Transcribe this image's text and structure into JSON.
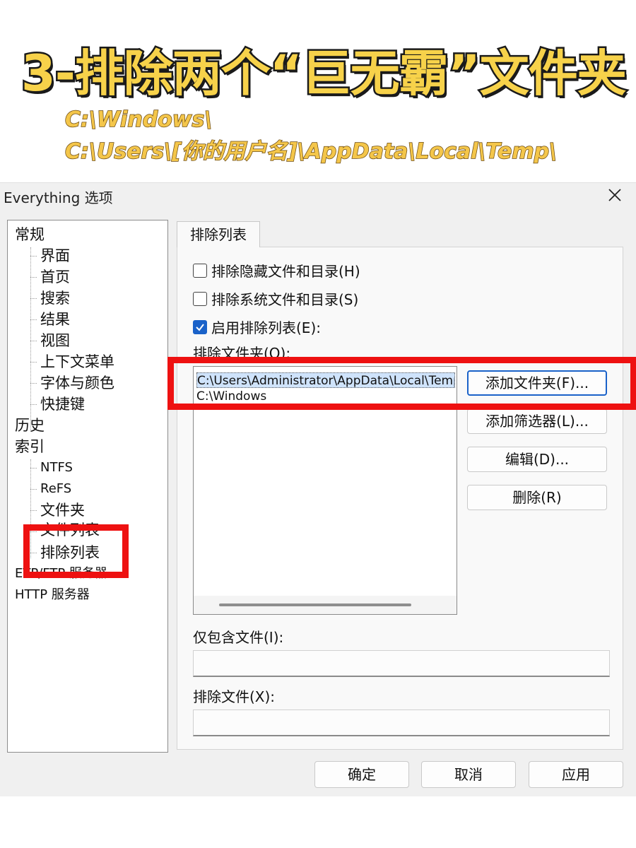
{
  "banner": {
    "title": "3-排除两个“巨无霸”文件夹",
    "paths": [
      "C:\\Windows\\",
      "C:\\Users\\[你的用户名]\\AppData\\Local\\Temp\\"
    ]
  },
  "dialog": {
    "title": "Everything 选项",
    "close_glyph": "✕",
    "tree": [
      {
        "id": "general",
        "label": "常规"
      },
      {
        "id": "ui",
        "label": "界面"
      },
      {
        "id": "home",
        "label": "首页"
      },
      {
        "id": "search",
        "label": "搜索"
      },
      {
        "id": "results",
        "label": "结果"
      },
      {
        "id": "view",
        "label": "视图"
      },
      {
        "id": "context-menu",
        "label": "上下文菜单"
      },
      {
        "id": "font-color",
        "label": "字体与颜色"
      },
      {
        "id": "shortcuts",
        "label": "快捷键"
      },
      {
        "id": "history",
        "label": "历史"
      },
      {
        "id": "index",
        "label": "索引"
      },
      {
        "id": "ntfs",
        "label": "NTFS"
      },
      {
        "id": "refs",
        "label": "ReFS"
      },
      {
        "id": "folders",
        "label": "文件夹"
      },
      {
        "id": "file-list",
        "label": "文件列表"
      },
      {
        "id": "exclude-list",
        "label": "排除列表"
      },
      {
        "id": "etp-ftp-server",
        "label": "ETP/FTP 服务器"
      },
      {
        "id": "http-server",
        "label": "HTTP 服务器"
      }
    ],
    "tab_label": "排除列表",
    "checkboxes": [
      {
        "label": "排除隐藏文件和目录(H)",
        "checked": false
      },
      {
        "label": "排除系统文件和目录(S)",
        "checked": false
      },
      {
        "label": "启用排除列表(E):",
        "checked": true
      }
    ],
    "exclude_folders_label": "排除文件夹(O):",
    "exclude_folders": [
      {
        "path": "C:\\Users\\Administrator\\AppData\\Local\\Temp",
        "selected": true
      },
      {
        "path": "C:\\Windows",
        "selected": false
      }
    ],
    "buttons": {
      "add_folder": "添加文件夹(F)...",
      "add_filter": "添加筛选器(L)...",
      "edit": "编辑(D)...",
      "remove": "删除(R)"
    },
    "include_files_label": "仅包含文件(I):",
    "include_files_value": "",
    "exclude_files_label": "排除文件(X):",
    "exclude_files_value": "",
    "footer": {
      "ok": "确定",
      "cancel": "取消",
      "apply": "应用"
    },
    "accent_color": "#1a62c9",
    "annotation_color": "#ee1111"
  }
}
